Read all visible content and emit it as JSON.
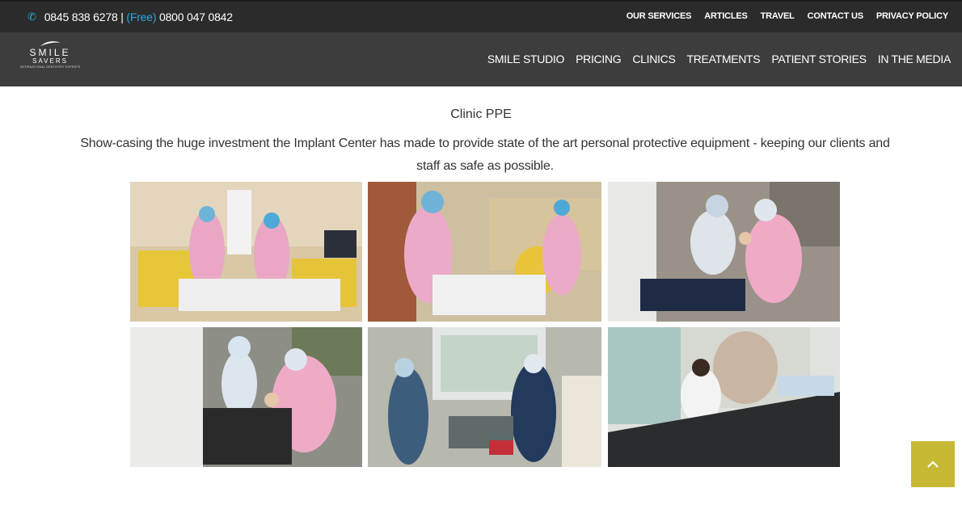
{
  "topbar": {
    "phone_number": "0845 838 6278",
    "separator": "|",
    "free_label": "(Free)",
    "free_number": "0800 047 0842",
    "links": [
      "OUR SERVICES",
      "ARTICLES",
      "TRAVEL",
      "CONTACT US",
      "PRIVACY POLICY"
    ]
  },
  "logo": {
    "line1": "SMILE",
    "line2": "SAVERS",
    "tagline": "INTERNATIONAL DENTISTRY EXPERTS"
  },
  "nav": [
    "SMILE STUDIO",
    "PRICING",
    "CLINICS",
    "TREATMENTS",
    "PATIENT STORIES",
    "IN THE MEDIA"
  ],
  "section": {
    "title": "Clinic PPE",
    "description": "Show-casing the huge investment the Implant Center has made to provide state of the art personal protective equipment - keeping our clients and staff as safe as possible."
  },
  "gallery": {
    "photos": [
      {
        "name": "photo-staff-ppe-1"
      },
      {
        "name": "photo-staff-ppe-2"
      },
      {
        "name": "photo-treatment-ppe-1"
      },
      {
        "name": "photo-treatment-ppe-2"
      },
      {
        "name": "photo-surgery-room"
      },
      {
        "name": "photo-reception-desk"
      }
    ]
  },
  "colors": {
    "topbar_bg": "#2b2b2b",
    "nav_bg": "#3d3d3d",
    "accent_blue": "#2aa8e0",
    "back_to_top": "#c8b935"
  },
  "icons": {
    "phone": "phone-icon",
    "back_to_top": "chevron-up-icon"
  }
}
